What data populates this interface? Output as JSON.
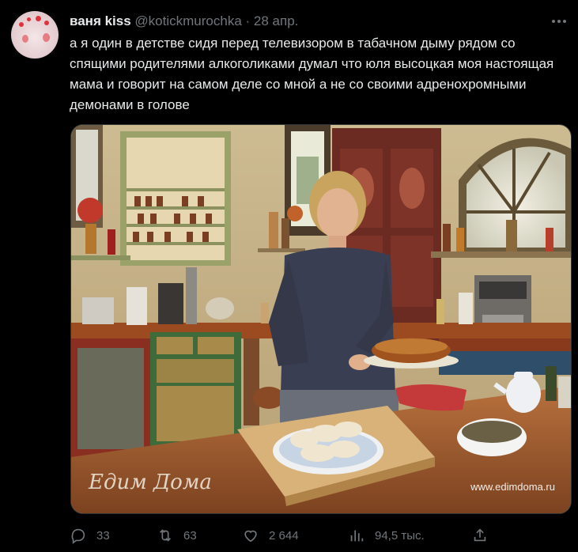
{
  "author": {
    "name": "ваня kiss",
    "handle": "@kotickmurochka",
    "separator": "·",
    "date": "28 апр."
  },
  "tweet": {
    "text": "а я один в детстве сидя перед телевизором в табачном дыму рядом со спящими родителями алкоголиками думал что юля высоцкая моя настоящая мама и говорит на самом деле со мной а не со своими адренохромными демонами в голове"
  },
  "media": {
    "watermark_logo": "Едим Дома",
    "watermark_url": "www.edimdoma.ru"
  },
  "actions": {
    "replies": "33",
    "retweets": "63",
    "likes": "2 644",
    "views": "94,5 тыс."
  },
  "icons": {
    "more": "more-icon",
    "reply": "reply-icon",
    "retweet": "retweet-icon",
    "like": "like-icon",
    "views": "views-icon",
    "share": "share-icon"
  },
  "colors": {
    "background": "#000000",
    "text": "#e7e9ea",
    "muted": "#71767b"
  }
}
